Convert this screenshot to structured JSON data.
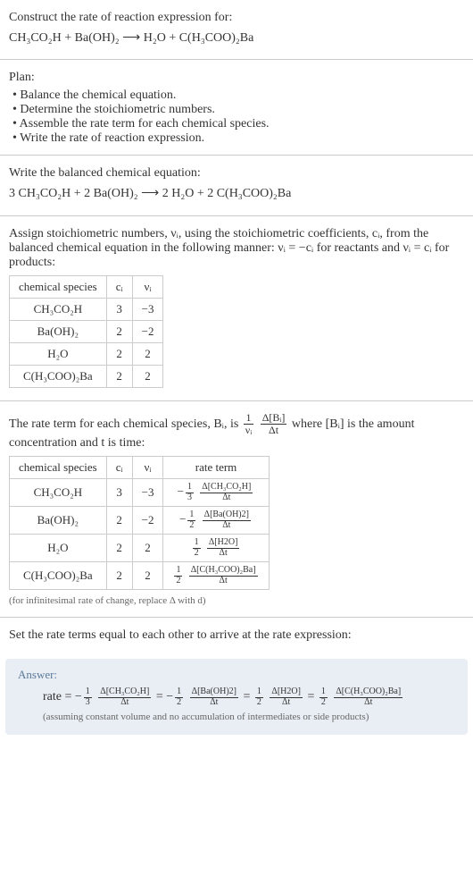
{
  "prompt": {
    "line1": "Construct the rate of reaction expression for:",
    "eq": "CH₃CO₂H + Ba(OH)₂  ⟶  H₂O + C(H₃COO)₂Ba"
  },
  "plan": {
    "title": "Plan:",
    "items": [
      "Balance the chemical equation.",
      "Determine the stoichiometric numbers.",
      "Assemble the rate term for each chemical species.",
      "Write the rate of reaction expression."
    ]
  },
  "balanced": {
    "title": "Write the balanced chemical equation:",
    "eq": "3 CH₃CO₂H + 2 Ba(OH)₂  ⟶  2 H₂O + 2 C(H₃COO)₂Ba"
  },
  "assign": {
    "intro_a": "Assign stoichiometric numbers, νᵢ, using the stoichiometric coefficients, cᵢ, from the balanced chemical equation in the following manner: νᵢ = −cᵢ for reactants and νᵢ = cᵢ for products:",
    "headers": [
      "chemical species",
      "cᵢ",
      "νᵢ"
    ],
    "rows": [
      {
        "sp": "CH₃CO₂H",
        "c": "3",
        "v": "−3"
      },
      {
        "sp": "Ba(OH)₂",
        "c": "2",
        "v": "−2"
      },
      {
        "sp": "H₂O",
        "c": "2",
        "v": "2"
      },
      {
        "sp": "C(H₃COO)₂Ba",
        "c": "2",
        "v": "2"
      }
    ]
  },
  "rateterm": {
    "intro_a": "The rate term for each chemical species, Bᵢ, is ",
    "intro_b": " where [Bᵢ] is the amount concentration and t is time:",
    "frac1_num": "1",
    "frac1_den": "νᵢ",
    "frac2_num": "Δ[Bᵢ]",
    "frac2_den": "Δt",
    "headers": [
      "chemical species",
      "cᵢ",
      "νᵢ",
      "rate term"
    ],
    "rows": [
      {
        "sp": "CH₃CO₂H",
        "c": "3",
        "v": "−3",
        "sign": "−",
        "cn": "1",
        "cd": "3",
        "dn": "Δ[CH₃CO₂H]",
        "dd": "Δt"
      },
      {
        "sp": "Ba(OH)₂",
        "c": "2",
        "v": "−2",
        "sign": "−",
        "cn": "1",
        "cd": "2",
        "dn": "Δ[Ba(OH)2]",
        "dd": "Δt"
      },
      {
        "sp": "H₂O",
        "c": "2",
        "v": "2",
        "sign": "",
        "cn": "1",
        "cd": "2",
        "dn": "Δ[H2O]",
        "dd": "Δt"
      },
      {
        "sp": "C(H₃COO)₂Ba",
        "c": "2",
        "v": "2",
        "sign": "",
        "cn": "1",
        "cd": "2",
        "dn": "Δ[C(H₃COO)₂Ba]",
        "dd": "Δt"
      }
    ],
    "note": "(for infinitesimal rate of change, replace Δ with d)"
  },
  "final": {
    "title": "Set the rate terms equal to each other to arrive at the rate expression:",
    "label": "Answer:",
    "prefix": "rate = ",
    "terms": [
      {
        "sign": "−",
        "cn": "1",
        "cd": "3",
        "dn": "Δ[CH₃CO₂H]",
        "dd": "Δt"
      },
      {
        "sign": "−",
        "cn": "1",
        "cd": "2",
        "dn": "Δ[Ba(OH)2]",
        "dd": "Δt"
      },
      {
        "sign": "",
        "cn": "1",
        "cd": "2",
        "dn": "Δ[H2O]",
        "dd": "Δt"
      },
      {
        "sign": "",
        "cn": "1",
        "cd": "2",
        "dn": "Δ[C(H₃COO)₂Ba]",
        "dd": "Δt"
      }
    ],
    "note": "(assuming constant volume and no accumulation of intermediates or side products)"
  }
}
